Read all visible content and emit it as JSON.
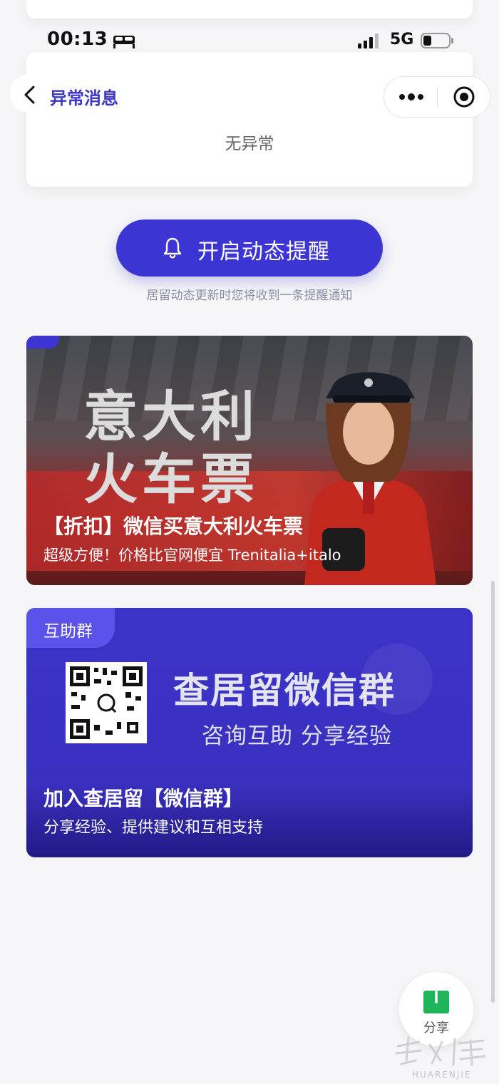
{
  "status_bar": {
    "time": "00:13",
    "network": "5G",
    "icons": [
      "bed-icon",
      "signal-icon",
      "battery-icon"
    ]
  },
  "nav": {
    "back_icon": "chevron-left-icon",
    "title": "异常消息",
    "more_icon": "more-dots-icon",
    "close_icon": "target-close-icon"
  },
  "abnormal": {
    "text": "无异常"
  },
  "reminder": {
    "button_label": "开启动态提醒",
    "icon": "bell-icon",
    "hint": "居留动态更新时您将收到一条提醒通知"
  },
  "train_banner": {
    "headline_1": "意大利",
    "headline_2": "火车票",
    "title": "【折扣】微信买意大利火车票",
    "subtitle": "超级方便！价格比官网便宜 Trenitalia+italo"
  },
  "group_banner": {
    "tag": "互助群",
    "headline": "查居留微信群",
    "tagline": "咨询互助 分享经验",
    "title": "加入查居留【微信群】",
    "subtitle": "分享经验、提供建议和互相支持"
  },
  "share": {
    "label": "分享",
    "icon": "share-icon"
  },
  "colors": {
    "accent": "#3d35d3",
    "share_green": "#1fb45a"
  }
}
